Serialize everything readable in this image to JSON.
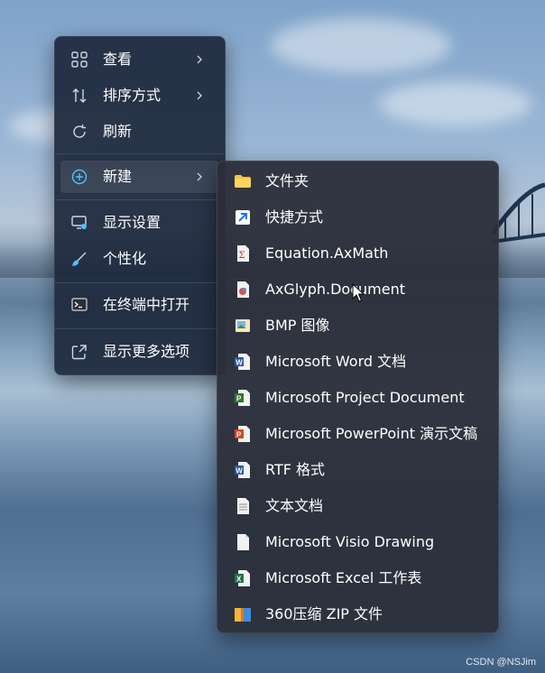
{
  "context_menu": {
    "items": [
      {
        "label": "查看",
        "icon": "grid-icon"
      },
      {
        "label": "排序方式",
        "icon": "sort-icon"
      },
      {
        "label": "刷新",
        "icon": "refresh-icon"
      },
      {
        "label": "新建",
        "icon": "add-circle-icon"
      },
      {
        "label": "显示设置",
        "icon": "display-settings-icon"
      },
      {
        "label": "个性化",
        "icon": "brush-icon"
      },
      {
        "label": "在终端中打开",
        "icon": "terminal-icon"
      },
      {
        "label": "显示更多选项",
        "icon": "open-external-icon"
      }
    ]
  },
  "new_submenu": {
    "items": [
      {
        "label": "文件夹",
        "icon": "folder-icon"
      },
      {
        "label": "快捷方式",
        "icon": "shortcut-icon"
      },
      {
        "label": "Equation.AxMath",
        "icon": "axmath-icon"
      },
      {
        "label": "AxGlyph.Document",
        "icon": "axglyph-icon"
      },
      {
        "label": "BMP 图像",
        "icon": "bmp-image-icon"
      },
      {
        "label": "Microsoft Word 文档",
        "icon": "word-doc-icon"
      },
      {
        "label": "Microsoft Project Document",
        "icon": "project-doc-icon"
      },
      {
        "label": "Microsoft PowerPoint 演示文稿",
        "icon": "powerpoint-icon"
      },
      {
        "label": "RTF 格式",
        "icon": "rtf-doc-icon"
      },
      {
        "label": "文本文档",
        "icon": "text-doc-icon"
      },
      {
        "label": "Microsoft Visio Drawing",
        "icon": "visio-doc-icon"
      },
      {
        "label": "Microsoft Excel 工作表",
        "icon": "excel-icon"
      },
      {
        "label": "360压缩 ZIP 文件",
        "icon": "zip-archive-icon"
      }
    ]
  },
  "watermark": "CSDN @NSJim",
  "colors": {
    "menu_bg": "#1e293c",
    "submenu_bg": "#2b2e3a",
    "accent": "#4cc2ff"
  }
}
